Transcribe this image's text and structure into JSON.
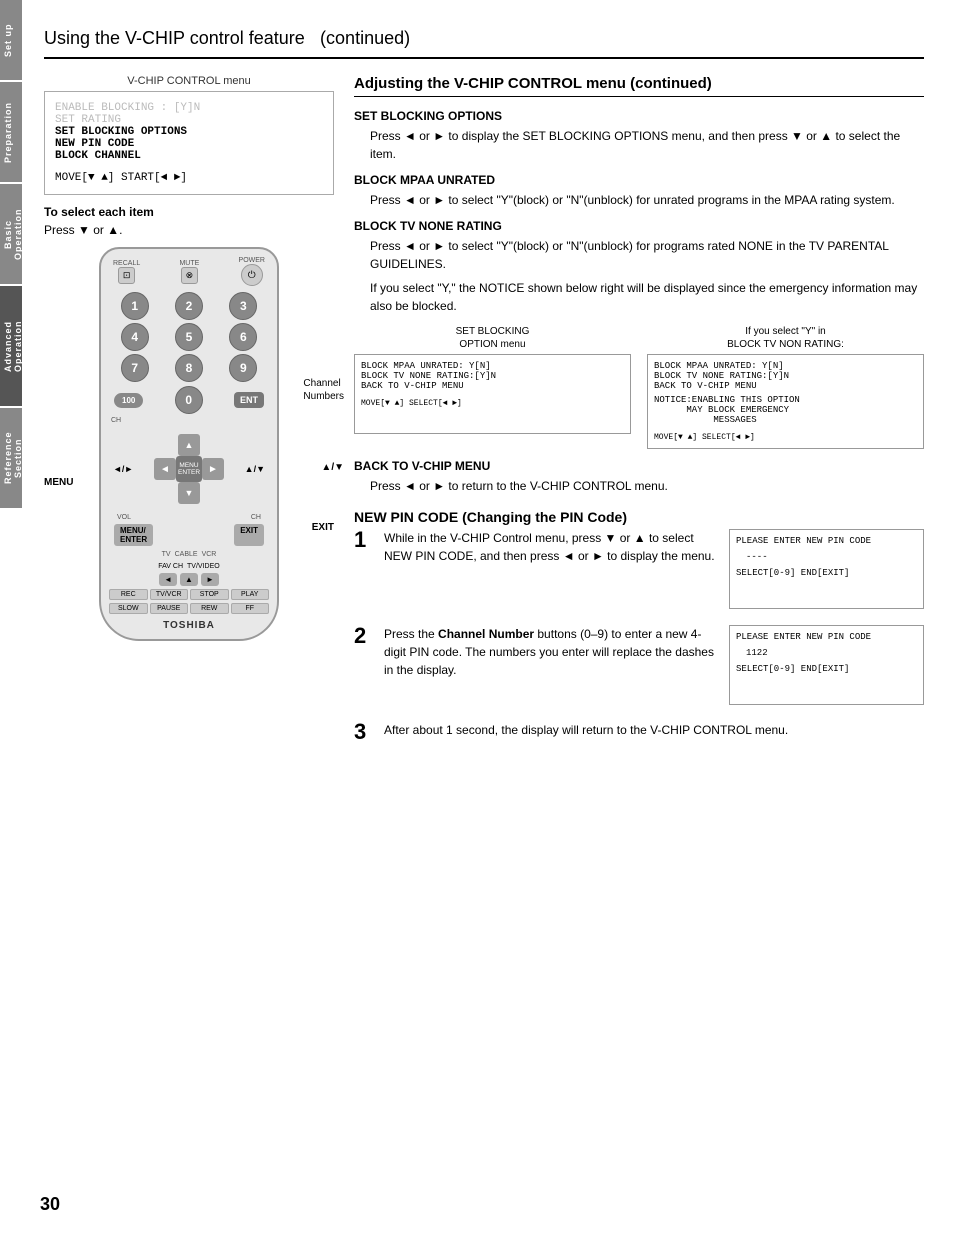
{
  "page": {
    "title": "Using the V-CHIP control feature",
    "title_suffix": "(continued)",
    "page_number": "30"
  },
  "side_tabs": [
    {
      "id": "setup",
      "label": "Set up"
    },
    {
      "id": "preparation",
      "label": "Preparation"
    },
    {
      "id": "basic",
      "label": "Basic Operation"
    },
    {
      "id": "advanced",
      "label": "Advanced Operation",
      "active": true
    },
    {
      "id": "reference",
      "label": "Reference Section"
    }
  ],
  "left_col": {
    "vchip_menu_label": "V-CHIP CONTROL menu",
    "menu_lines": [
      {
        "text": "ENABLE BLOCKING : [Y]N",
        "dim": true
      },
      {
        "text": "SET RATING",
        "dim": true
      },
      {
        "text": "SET BLOCKING OPTIONS",
        "bold": true
      },
      {
        "text": "NEW PIN CODE",
        "bold": true
      },
      {
        "text": "BLOCK CHANNEL",
        "bold": true
      }
    ],
    "menu_move": "MOVE[▼ ▲] START[◄ ►]",
    "select_each_label": "To select each item",
    "press_label": "Press ▼ or ▲.",
    "annotations": {
      "menu": "MENU",
      "exit": "EXIT",
      "channel_numbers": "Channel\nNumbers",
      "nav_updown": "▲/▼"
    }
  },
  "right_col": {
    "section_title": "Adjusting the V-CHIP CONTROL menu (continued)",
    "set_blocking": {
      "title": "SET BLOCKING OPTIONS",
      "text": "Press ◄ or ►  to display the SET BLOCKING OPTIONS menu, and then press ▼ or ▲  to select the item."
    },
    "block_mpaa": {
      "title": "BLOCK MPAA UNRATED",
      "text": "Press ◄ or ►  to select \"Y\"(block) or \"N\"(unblock) for unrated programs in the MPAA rating system."
    },
    "block_tv_none": {
      "title": "BLOCK TV NONE RATING",
      "text1": "Press ◄ or ►  to select \"Y\"(block) or \"N\"(unblock) for programs rated NONE in the TV PARENTAL GUIDELINES.",
      "text2": "If you select \"Y,\" the NOTICE shown below right will be displayed since the emergency information may also be blocked."
    },
    "screens": {
      "left_label": "SET BLOCKING\nOPTION menu",
      "left_lines": [
        "BLOCK MPAA UNRATED:  Y[N]",
        "BLOCK TV NONE RATING:[Y]N",
        "BACK TO V-CHIP MENU"
      ],
      "left_move": "MOVE[▼ ▲] SELECT[◄ ►]",
      "right_label": "If you select \"Y\" in\nBLOCK TV NON RATING:",
      "right_lines": [
        "BLOCK MPAA UNRATED:   Y[N]",
        "BLOCK TV NONE RATING:[Y]N",
        "BACK TO V-CHIP MENU",
        "",
        "NOTICE:ENABLING THIS OPTION",
        "      MAY BLOCK EMERGENCY",
        "           MESSAGES"
      ],
      "right_move": "MOVE[▼ ▲] SELECT[◄ ►]"
    },
    "back_to_vchip": {
      "title": "BACK TO V-CHIP MENU",
      "text": "Press ◄ or ►  to return to the V-CHIP CONTROL menu."
    },
    "new_pin": {
      "title": "NEW PIN CODE (Changing the PIN Code)"
    },
    "steps": [
      {
        "num": "1",
        "text": "While in the V-CHIP Control menu, press ▼ or ▲ to select NEW PIN CODE, and then press ◄ or ►  to display the menu.",
        "screen_lines": [
          "PLEASE ENTER NEW PIN CODE",
          "",
          "    ----",
          "",
          "SELECT[0-9] END[EXIT]"
        ]
      },
      {
        "num": "2",
        "text": "Press the Channel Number buttons (0–9) to enter a new 4-digit  PIN code. The numbers you enter will replace the dashes in the display.",
        "screen_lines": [
          "PLEASE ENTER NEW PIN CODE",
          "",
          "    1122",
          "",
          "SELECT[0-9] END[EXIT]"
        ]
      },
      {
        "num": "3",
        "text": "After about 1 second, the display will return to the V-CHIP CONTROL menu.",
        "screen_lines": []
      }
    ]
  }
}
